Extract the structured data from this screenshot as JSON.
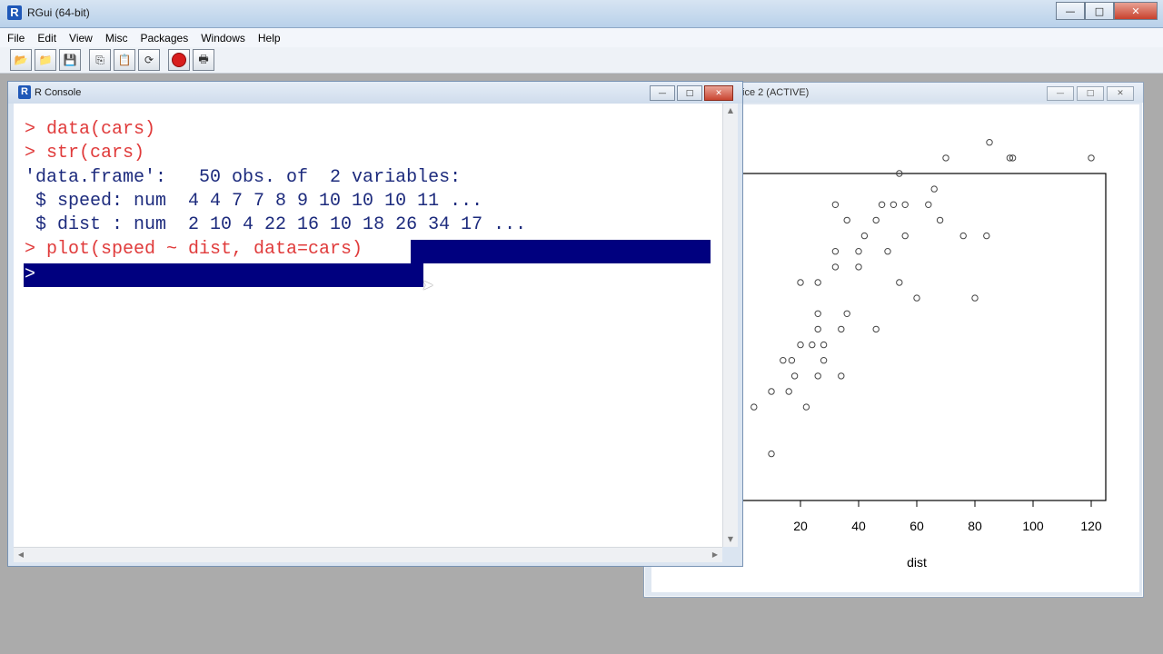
{
  "app": {
    "title": "RGui (64-bit)",
    "icon_letter": "R",
    "controls": {
      "minimize": "—",
      "maximize": "□",
      "close": "✕"
    }
  },
  "menu": [
    "File",
    "Edit",
    "View",
    "Misc",
    "Packages",
    "Windows",
    "Help"
  ],
  "toolbar": [
    {
      "name": "open-script-icon",
      "glyph": "📂"
    },
    {
      "name": "load-workspace-icon",
      "glyph": "📁"
    },
    {
      "name": "save-workspace-icon",
      "glyph": "💾"
    },
    {
      "name": "copy-icon",
      "glyph": "⎘"
    },
    {
      "name": "paste-icon",
      "glyph": "📋"
    },
    {
      "name": "copy-paste-icon",
      "glyph": "⟳"
    },
    {
      "name": "stop-icon",
      "glyph": ""
    },
    {
      "name": "print-icon",
      "glyph": "🖶"
    }
  ],
  "graphics_window": {
    "title_visible": "ice 2 (ACTIVE)",
    "controls": {
      "minimize": "—",
      "maximize": "□",
      "close": "✕"
    }
  },
  "console": {
    "title": "R Console",
    "icon_letter": "R",
    "controls": {
      "minimize": "—",
      "maximize": "□",
      "close": "✕"
    },
    "lines": [
      {
        "text": "> data(cars)",
        "kind": "in"
      },
      {
        "text": "> str(cars)",
        "kind": "in"
      },
      {
        "text": "'data.frame':   50 obs. of  2 variables:",
        "kind": "out"
      },
      {
        "text": " $ speed: num  4 4 7 7 8 9 10 10 10 11 ...",
        "kind": "out"
      },
      {
        "text": " $ dist : num  2 10 4 22 16 10 18 26 34 17 ...",
        "kind": "out"
      },
      {
        "text": "> plot(speed ~ dist, data=cars)",
        "kind": "in"
      }
    ],
    "prompt": ">"
  },
  "chart_data": {
    "type": "scatter",
    "xlabel": "dist",
    "ylabel": "",
    "xlim": [
      0,
      125
    ],
    "ylim": [
      4,
      25
    ],
    "x_ticks": [
      "20",
      "40",
      "60",
      "80",
      "100",
      "120"
    ],
    "x_tick_values": [
      20,
      40,
      60,
      80,
      100,
      120
    ],
    "points": [
      [
        10,
        7
      ],
      [
        4,
        10
      ],
      [
        22,
        10
      ],
      [
        16,
        11
      ],
      [
        10,
        11
      ],
      [
        18,
        12
      ],
      [
        26,
        12
      ],
      [
        34,
        12
      ],
      [
        17,
        13
      ],
      [
        28,
        13
      ],
      [
        14,
        13
      ],
      [
        20,
        14
      ],
      [
        24,
        14
      ],
      [
        28,
        14
      ],
      [
        26,
        15
      ],
      [
        34,
        15
      ],
      [
        46,
        15
      ],
      [
        26,
        16
      ],
      [
        36,
        16
      ],
      [
        60,
        17
      ],
      [
        80,
        17
      ],
      [
        20,
        18
      ],
      [
        26,
        18
      ],
      [
        54,
        18
      ],
      [
        32,
        19
      ],
      [
        40,
        19
      ],
      [
        32,
        20
      ],
      [
        40,
        20
      ],
      [
        50,
        20
      ],
      [
        42,
        21
      ],
      [
        56,
        21
      ],
      [
        76,
        21
      ],
      [
        84,
        21
      ],
      [
        36,
        22
      ],
      [
        46,
        22
      ],
      [
        68,
        22
      ],
      [
        32,
        23
      ],
      [
        48,
        23
      ],
      [
        52,
        23
      ],
      [
        56,
        23
      ],
      [
        64,
        23
      ],
      [
        66,
        24
      ],
      [
        54,
        25
      ],
      [
        70,
        26
      ],
      [
        92,
        26
      ],
      [
        93,
        26
      ],
      [
        120,
        26
      ],
      [
        85,
        27
      ]
    ],
    "marker": "open-circle",
    "color": "#444444"
  },
  "colors": {
    "console_input": "#e03b3b",
    "console_output": "#1d2b7d",
    "selection": "#00007f"
  }
}
